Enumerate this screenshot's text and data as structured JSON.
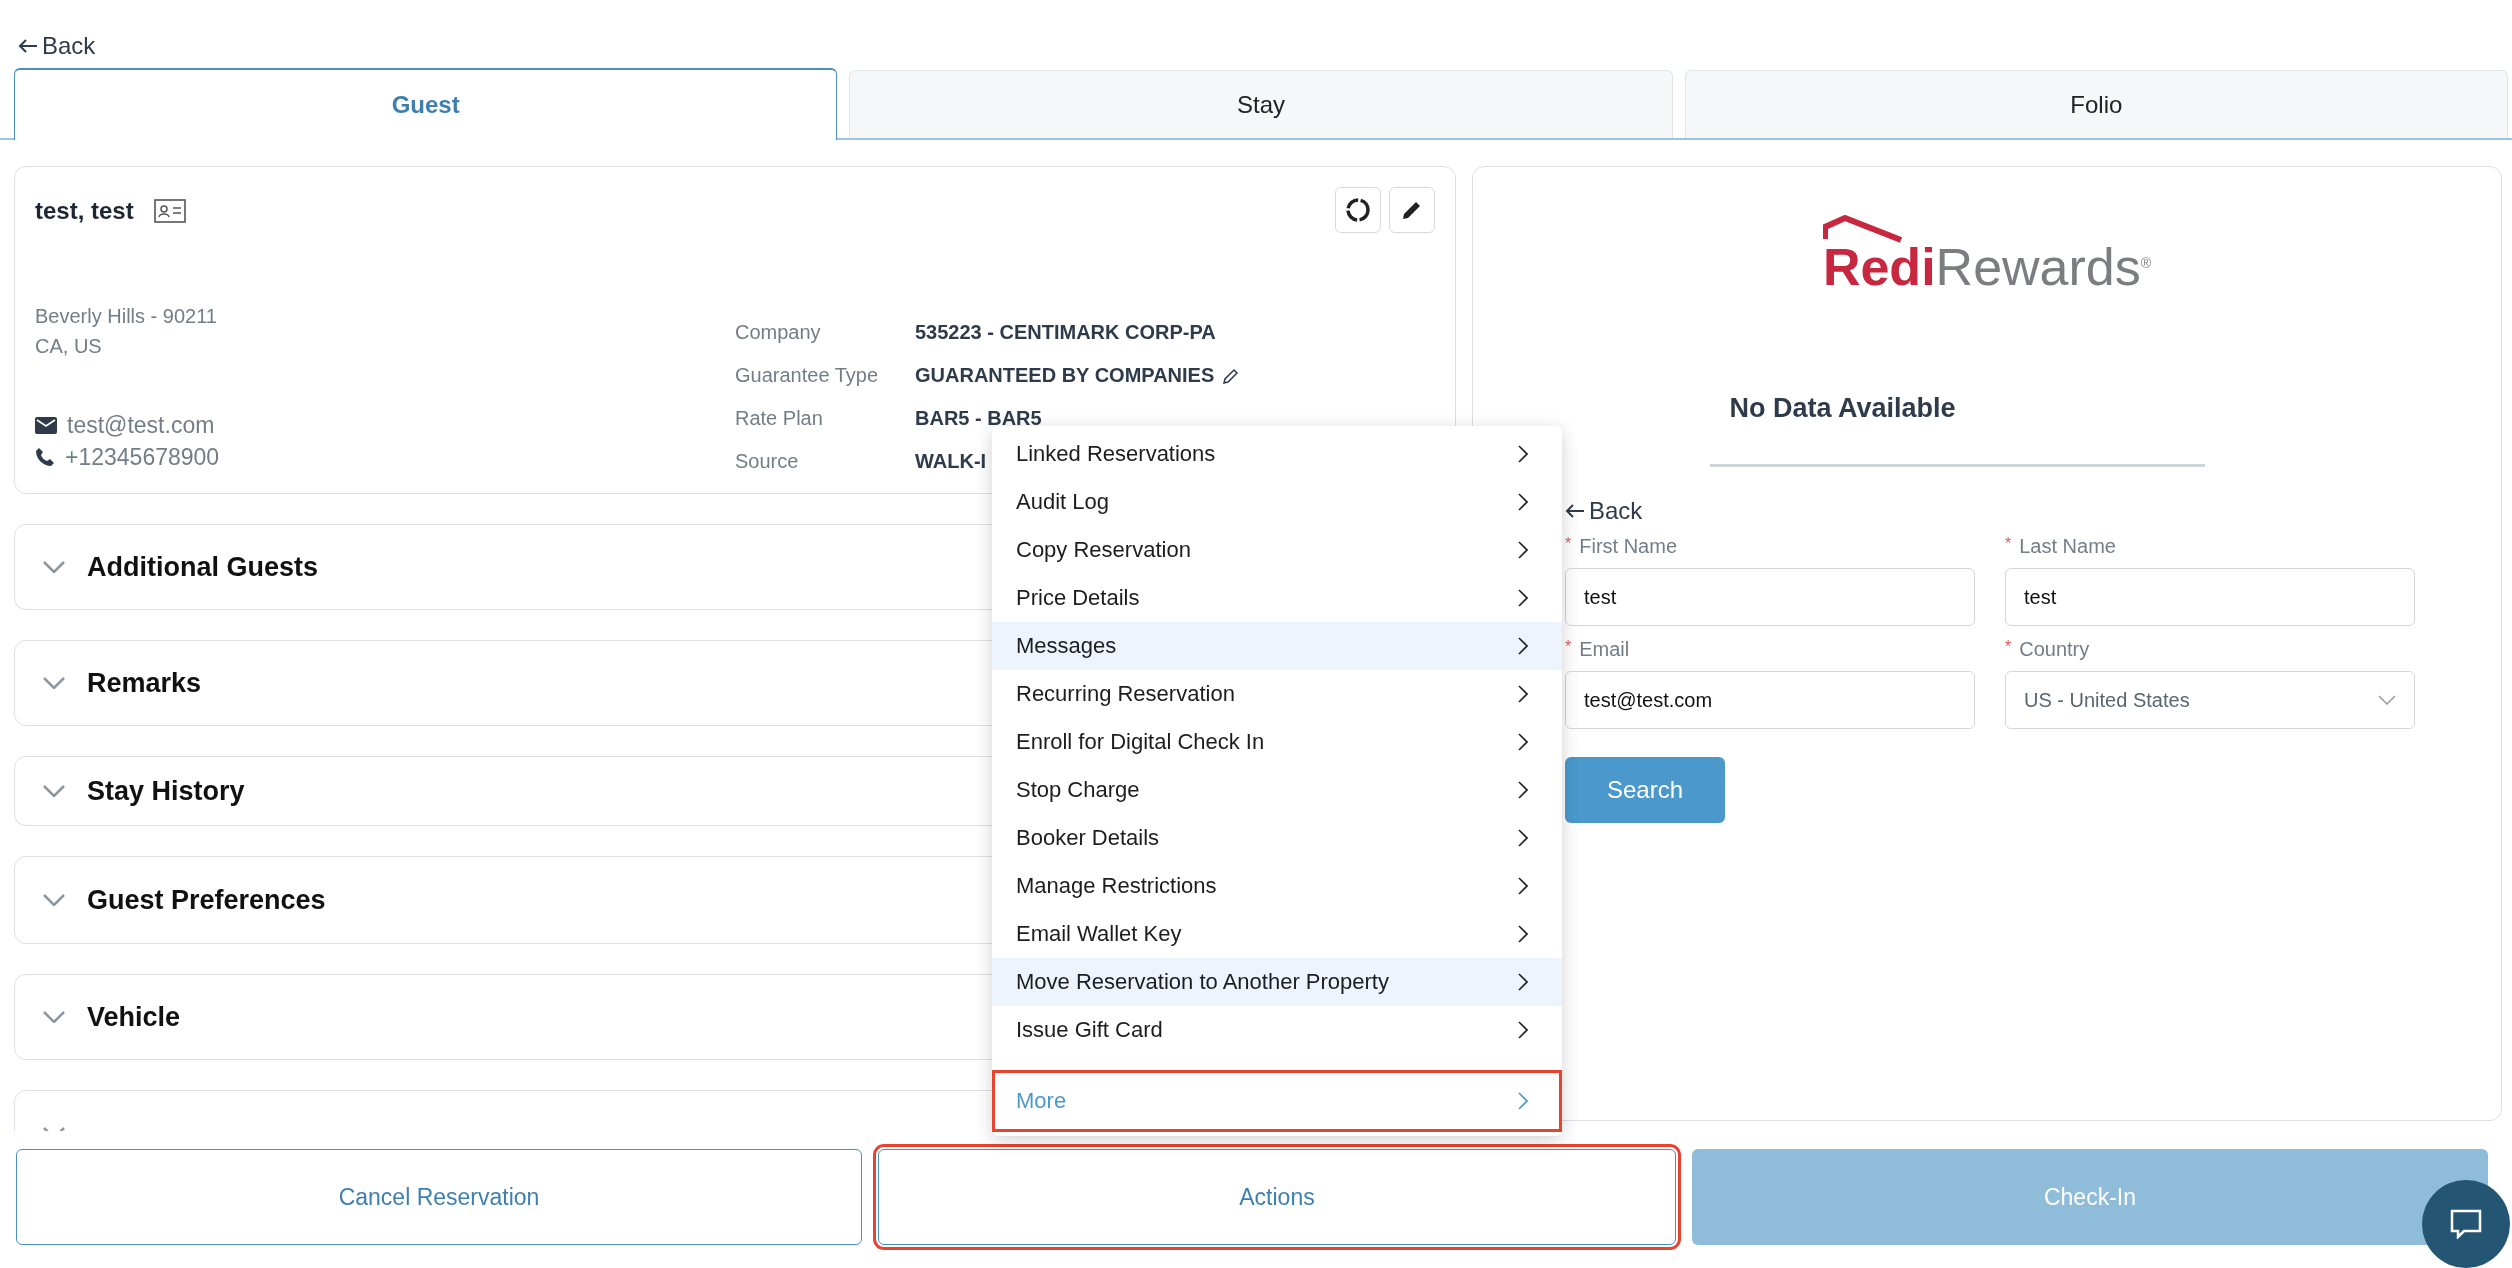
{
  "back_link": "Back",
  "tabs": [
    {
      "label": "Guest",
      "selected": true
    },
    {
      "label": "Stay",
      "selected": false
    },
    {
      "label": "Folio",
      "selected": false
    }
  ],
  "guest": {
    "name": "test, test",
    "address_lines": [
      "Beverly Hills  - 90211",
      "CA, US"
    ],
    "email": "test@test.com",
    "phone": "+12345678900",
    "details": [
      {
        "label": "Company",
        "value": "535223 - CENTIMARK CORP-PA",
        "editable": false
      },
      {
        "label": "Guarantee Type",
        "value": "GUARANTEED BY COMPANIES",
        "editable": true
      },
      {
        "label": "Rate Plan",
        "value": "BAR5 - BAR5",
        "editable": false
      },
      {
        "label": "Source",
        "value": "WALK-I"
      }
    ]
  },
  "sections": [
    {
      "title": "Additional Guests"
    },
    {
      "title": "Remarks"
    },
    {
      "title": "Stay History"
    },
    {
      "title": "Guest Preferences"
    },
    {
      "title": "Vehicle",
      "kind": "full"
    },
    {
      "kind": "partial"
    }
  ],
  "rewards": {
    "logo": {
      "part1": "Redi",
      "part2": "Rewards",
      "mark": "®"
    },
    "status": "No Data Available",
    "back_link": "Back",
    "required_mark": "*",
    "fields": [
      {
        "label": "First Name",
        "required": true,
        "value": "test",
        "kind": "text"
      },
      {
        "label": "Last Name",
        "required": true,
        "value": "test",
        "kind": "text"
      },
      {
        "label": "Email",
        "required": true,
        "value": "test@test.com",
        "kind": "text"
      },
      {
        "label": "Country",
        "required": true,
        "value": "US - United States",
        "kind": "select"
      }
    ],
    "search_button": "Search"
  },
  "menu": [
    {
      "label": "Linked Reservations",
      "highlighted": false,
      "kind": "item",
      "outlined": false
    },
    {
      "label": "Audit Log",
      "highlighted": false,
      "kind": "item",
      "outlined": false
    },
    {
      "label": "Copy Reservation",
      "highlighted": false,
      "kind": "item",
      "outlined": false
    },
    {
      "label": "Price Details",
      "highlighted": false,
      "kind": "item",
      "outlined": false
    },
    {
      "label": "Messages",
      "highlighted": true,
      "kind": "item",
      "outlined": false
    },
    {
      "label": "Recurring Reservation",
      "highlighted": false,
      "kind": "item",
      "outlined": false
    },
    {
      "label": "Enroll for Digital Check In",
      "highlighted": false,
      "kind": "item",
      "outlined": false
    },
    {
      "label": "Stop Charge",
      "highlighted": false,
      "kind": "item",
      "outlined": false
    },
    {
      "label": "Booker Details",
      "highlighted": false,
      "kind": "item",
      "outlined": false
    },
    {
      "label": "Manage Restrictions",
      "highlighted": false,
      "kind": "item",
      "outlined": false
    },
    {
      "label": "Email Wallet Key",
      "highlighted": false,
      "kind": "item",
      "outlined": false
    },
    {
      "label": "Move Reservation to Another Property",
      "highlighted": true,
      "kind": "item",
      "outlined": false
    },
    {
      "label": "Issue Gift Card",
      "highlighted": false,
      "kind": "item",
      "outlined": false
    },
    {
      "label": "More",
      "highlighted": false,
      "kind": "more",
      "outlined": true
    }
  ],
  "footer": [
    {
      "label": "Cancel Reservation",
      "disabled": false,
      "outlined": false
    },
    {
      "label": "Actions",
      "disabled": false,
      "outlined": true
    },
    {
      "label": "Check-In",
      "disabled": true,
      "outlined": false
    }
  ]
}
